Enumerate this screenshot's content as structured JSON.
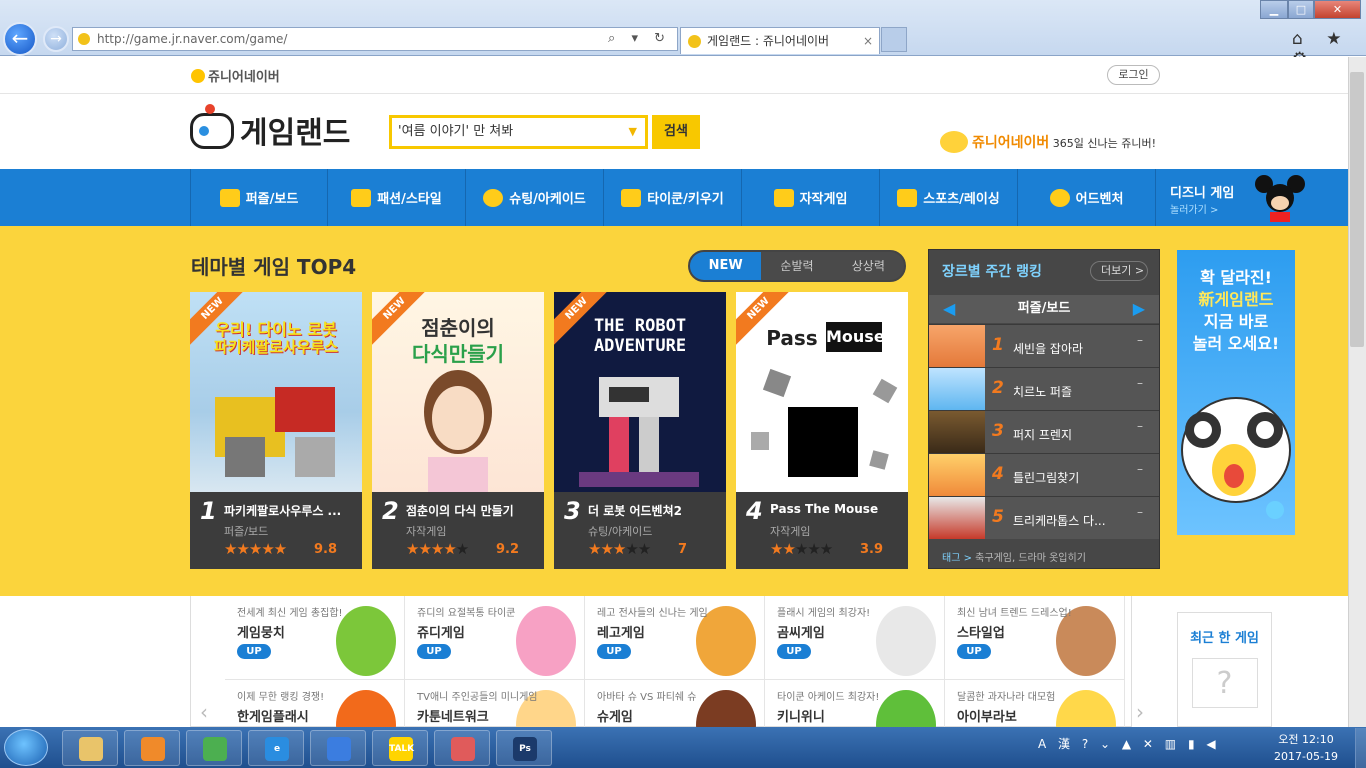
{
  "browser": {
    "url": "http://game.jr.naver.com/game/",
    "tab_title": "게임랜드 : 쥬니어네이버",
    "tab_close": "×",
    "back_icon": "←",
    "forward_icon": "→",
    "addr_tools": "⌕ ▾ ↻",
    "minimize": "▁",
    "maximize": "□",
    "close": "✕",
    "right_tools": "⌂ ★ ⚙"
  },
  "site": {
    "jr_logo": "쥬니어네이버",
    "login": "로그인",
    "brand": "게임랜드",
    "search_value": "'여름 이야기' 만 쳐봐",
    "search_arrow": "▼",
    "search_button": "검색",
    "slogan_brand": "쥬니어네이버",
    "slogan_text": "365일 신나는 쥬니버!"
  },
  "nav": {
    "items": [
      "퍼즐/보드",
      "패션/스타일",
      "슈팅/아케이드",
      "타이쿤/키우기",
      "자작게임",
      "스포츠/레이싱",
      "어드벤처"
    ],
    "disney_title": "디즈니 게임",
    "disney_sub": "놀러가기 >"
  },
  "top4": {
    "title": "테마별 게임 TOP4",
    "tabs": [
      "NEW",
      "순발력",
      "상상력"
    ],
    "ribbon": "NEW",
    "cards": [
      {
        "rank": "1",
        "name": "파키케팔로사우루스 ...",
        "category": "퍼즐/보드",
        "stars_on": "★★★★★",
        "stars_off": "",
        "score": "9.8",
        "art_line1": "우리! 다이노 로봇",
        "art_line2": "파키케팔로사우루스"
      },
      {
        "rank": "2",
        "name": "점춘이의 다식 만들기",
        "category": "자작게임",
        "stars_on": "★★★★",
        "stars_off": "★",
        "score": "9.2",
        "art_line1": "점춘이의",
        "art_line2": "다식만들기"
      },
      {
        "rank": "3",
        "name": "더 로봇 어드벤쳐2",
        "category": "슈팅/아케이드",
        "stars_on": "★★★",
        "stars_off": "★★",
        "score": "7",
        "art_line1": "THE ROBOT",
        "art_line2": "ADVENTURE"
      },
      {
        "rank": "4",
        "name": "Pass The Mouse",
        "category": "자작게임",
        "stars_on": "★★",
        "stars_off": "★★★",
        "score": "3.9",
        "art_line1": "Pass",
        "art_line2": "Mouse"
      }
    ]
  },
  "ranking": {
    "title": "장르별 주간 랭킹",
    "more": "더보기 >",
    "category": "퍼즐/보드",
    "prev_icon": "◀",
    "next_icon": "▶",
    "items": [
      {
        "rank": "1",
        "title": "세빈을 잡아라",
        "delta": "–"
      },
      {
        "rank": "2",
        "title": "치르노 퍼즐",
        "delta": "–"
      },
      {
        "rank": "3",
        "title": "퍼지 프렌지",
        "delta": "–"
      },
      {
        "rank": "4",
        "title": "틀린그림찾기",
        "delta": "–"
      },
      {
        "rank": "5",
        "title": "트리케라톱스 다...",
        "delta": "–"
      }
    ],
    "tag_label": "태그 >",
    "tags": "축구게임, 드라마 옷입히기"
  },
  "banner": {
    "line1": "확 달라진!",
    "line2": "新게임랜드",
    "line3": "지금 바로",
    "line4": "놀러 오세요!"
  },
  "bottom": {
    "up": "UP",
    "prev_icon": "‹",
    "next_icon": "›",
    "row1": [
      {
        "desc": "전세계 최신 게임 총집합!",
        "name": "게임뭉치",
        "color": "#7cc73a"
      },
      {
        "desc": "쥬디의 요절복통 타이쿤",
        "name": "쥬디게임",
        "color": "#f7a1c4"
      },
      {
        "desc": "레고 전사들의 신나는 게임",
        "name": "레고게임",
        "color": "#f0a63a"
      },
      {
        "desc": "플래시 게임의 최강자!",
        "name": "곰씨게임",
        "color": "#e8e8e8"
      },
      {
        "desc": "최신 남녀 트렌드 드레스업!",
        "name": "스타일업",
        "color": "#c98a5a"
      }
    ],
    "row2": [
      {
        "desc": "이제 무한 랭킹 경쟁!",
        "name": "한게임플래시",
        "color": "#f26a1b"
      },
      {
        "desc": "TV애니 주인공들의 미니게임",
        "name": "카툰네트워크",
        "color": "#ffd68a"
      },
      {
        "desc": "아바타 슈 VS 파티쉐 슈",
        "name": "슈게임",
        "color": "#7b3c22"
      },
      {
        "desc": "타이쿤 아케이드 최강자!",
        "name": "키니위니",
        "color": "#5fbf3a"
      },
      {
        "desc": "달콤한 과자나라 대모험",
        "name": "아이부라보",
        "color": "#ffd84a"
      }
    ],
    "recent_title": "최근 한 게임",
    "recent_placeholder": "?"
  },
  "taskbar": {
    "apps": [
      "file-explorer",
      "media-player",
      "chrome",
      "internet-explorer",
      "google-docs",
      "kakaotalk",
      "snipping-tool",
      "photoshop"
    ],
    "app_colors": [
      "#e9c46a",
      "#f08a2a",
      "#4caf50",
      "#2a8de0",
      "#3b7de0",
      "#ffd400",
      "#e05b5b",
      "#1b3a6b"
    ],
    "app_labels": [
      "",
      "",
      "",
      "e",
      "",
      "TALK",
      "",
      "Ps"
    ],
    "tray": "A 漢 ? ⌄ ▲ ✕ ▥ ▮ ◀",
    "time": "오전 12:10",
    "date": "2017-05-19"
  }
}
